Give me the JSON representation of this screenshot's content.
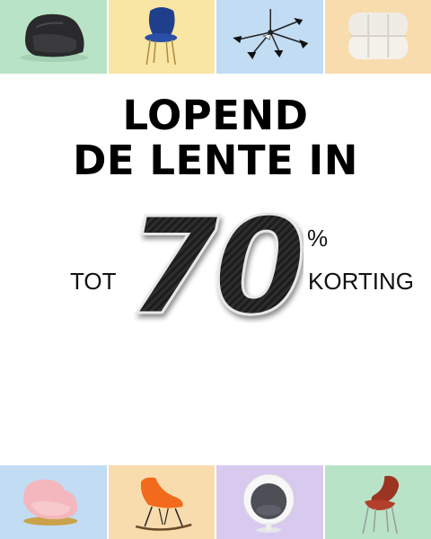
{
  "headline": {
    "line1": "LOPEND",
    "line2": "DE LENTE IN"
  },
  "offer": {
    "prefix": "TOT",
    "value": "70",
    "percent": "%",
    "suffix": "KORTING"
  },
  "tiles_top": [
    {
      "product": "lounge-chair-icon",
      "bg": "#b9e3c7"
    },
    {
      "product": "dining-chair-icon",
      "bg": "#f9e6a4"
    },
    {
      "product": "pendant-lamp-icon",
      "bg": "#c2dcf3"
    },
    {
      "product": "sofa-module-icon",
      "bg": "#f8dcae"
    }
  ],
  "tiles_bottom": [
    {
      "product": "pink-armchair-icon",
      "bg": "#c2dcf3"
    },
    {
      "product": "rocking-chair-icon",
      "bg": "#f8dcae"
    },
    {
      "product": "ball-chair-icon",
      "bg": "#d8c9ee"
    },
    {
      "product": "red-chair-icon",
      "bg": "#b9e3c7"
    }
  ]
}
